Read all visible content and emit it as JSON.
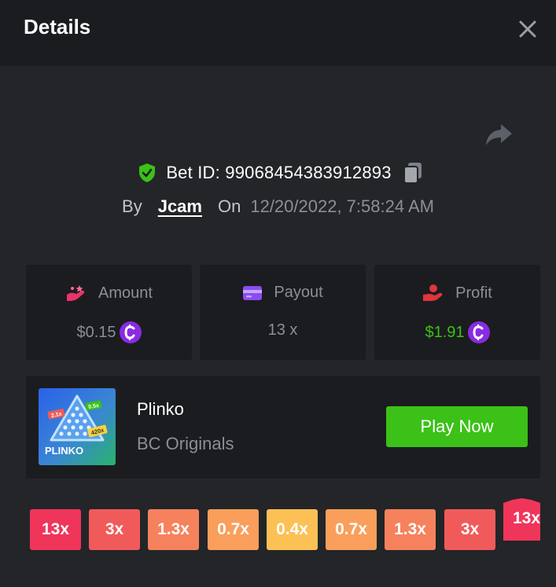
{
  "header": {
    "title": "Details"
  },
  "bet": {
    "id_text": "Bet ID: 99068454383912893",
    "by_label": "By",
    "user": "Jcam",
    "on_label": "On",
    "date": "12/20/2022, 7:58:24 AM"
  },
  "stats": {
    "amount": {
      "label": "Amount",
      "value": "$0.15",
      "icon": "amount-icon",
      "color": "#e8336b"
    },
    "payout": {
      "label": "Payout",
      "value": "13 x",
      "icon": "payout-card-icon",
      "color": "#8a4df2"
    },
    "profit": {
      "label": "Profit",
      "value": "$1.91",
      "icon": "profit-hand-icon",
      "color": "#e0343f"
    }
  },
  "coin_symbol": "¢",
  "game": {
    "name": "Plinko",
    "provider": "BC Originals",
    "play_label": "Play Now",
    "thumb_text": "PLINKO",
    "thumb_tags": [
      "2.1x",
      "0.5x",
      "420x"
    ]
  },
  "multipliers": [
    {
      "label": "13x",
      "color": "#f0355b"
    },
    {
      "label": "3x",
      "color": "#f15a5a"
    },
    {
      "label": "1.3x",
      "color": "#f6825d"
    },
    {
      "label": "0.7x",
      "color": "#f99f5b"
    },
    {
      "label": "0.4x",
      "color": "#fcc155"
    },
    {
      "label": "0.7x",
      "color": "#f99f5b"
    },
    {
      "label": "1.3x",
      "color": "#f6825d"
    },
    {
      "label": "3x",
      "color": "#f15a5a"
    }
  ],
  "active_multiplier": {
    "label": "13x",
    "color": "#f0355b"
  },
  "colors": {
    "accent_green": "#3bc117",
    "coin_purple": "#8a2be2"
  }
}
